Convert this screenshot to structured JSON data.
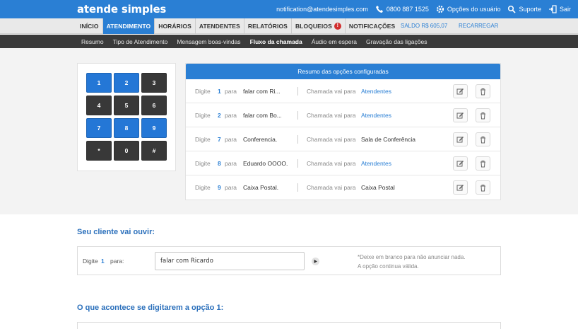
{
  "brand": {
    "logo": "atende simples"
  },
  "topbar": {
    "email": "notification@atendesimples.com",
    "phone": "0800 887 1525",
    "user_options": "Opções do usuário",
    "support": "Suporte",
    "logout": "Sair"
  },
  "mainnav": {
    "tabs": [
      {
        "label": "INÍCIO",
        "active": false
      },
      {
        "label": "ATENDIMENTO",
        "active": true
      },
      {
        "label": "HORÁRIOS",
        "active": false
      },
      {
        "label": "ATENDENTES",
        "active": false
      },
      {
        "label": "RELATÓRIOS",
        "active": false
      },
      {
        "label": "BLOQUEIOS",
        "active": false,
        "badge": "!"
      },
      {
        "label": "NOTIFICAÇÕES",
        "active": false
      }
    ],
    "saldo": "SALDO R$ 605,07",
    "recarregar": "RECARREGAR"
  },
  "subnav": {
    "items": [
      {
        "label": "Resumo",
        "active": false
      },
      {
        "label": "Tipo de Atendimento",
        "active": false
      },
      {
        "label": "Mensagem boas-vindas",
        "active": false
      },
      {
        "label": "Fluxo da chamada",
        "active": true
      },
      {
        "label": "Áudio em espera",
        "active": false
      },
      {
        "label": "Gravação das ligações",
        "active": false
      }
    ]
  },
  "keypad": {
    "keys": [
      {
        "label": "1",
        "configured": true
      },
      {
        "label": "2",
        "configured": true
      },
      {
        "label": "3",
        "configured": false
      },
      {
        "label": "4",
        "configured": false
      },
      {
        "label": "5",
        "configured": false
      },
      {
        "label": "6",
        "configured": false
      },
      {
        "label": "7",
        "configured": true
      },
      {
        "label": "8",
        "configured": true
      },
      {
        "label": "9",
        "configured": true
      },
      {
        "label": "*",
        "configured": false
      },
      {
        "label": "0",
        "configured": false
      },
      {
        "label": "#",
        "configured": false
      }
    ]
  },
  "summary": {
    "title": "Resumo das opções configuradas",
    "digite_label": "Digite",
    "para_label": "para",
    "chamada_label": "Chamada vai para",
    "rows": [
      {
        "digit": "1",
        "action": "falar com Ri...",
        "destination": "Atendentes",
        "link": true
      },
      {
        "digit": "2",
        "action": "falar com Bo...",
        "destination": "Atendentes",
        "link": true
      },
      {
        "digit": "7",
        "action": "Conferencia.",
        "destination": "Sala de Conferência",
        "link": false
      },
      {
        "digit": "8",
        "action": "Eduardo OOOO.",
        "destination": "Atendentes",
        "link": true
      },
      {
        "digit": "9",
        "action": "Caixa Postal.",
        "destination": "Caixa Postal",
        "link": false
      }
    ]
  },
  "section1": {
    "title": "Seu cliente vai ouvir:",
    "digite": "Digite",
    "digit": "1",
    "para": "para:",
    "input_value": "falar com Ricardo",
    "note_line1": "*Deixe em branco para não anunciar nada.",
    "note_line2": "A opção continua válida."
  },
  "section2": {
    "title": "O que acontece se digitarem a opção 1:"
  },
  "colors": {
    "primary": "#2a7fd4",
    "dark": "#383838",
    "alert": "#d12e2e"
  }
}
